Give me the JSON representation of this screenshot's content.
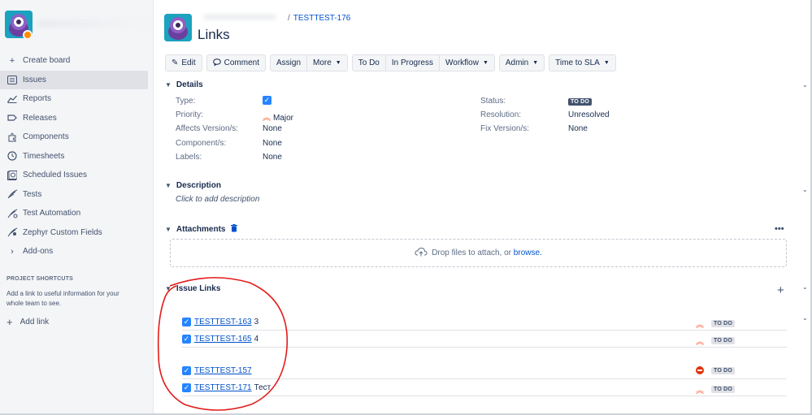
{
  "sidebar": {
    "items": [
      {
        "label": "Create board",
        "icon": "plus-icon"
      },
      {
        "label": "Issues",
        "icon": "issues-icon",
        "active": true
      },
      {
        "label": "Reports",
        "icon": "reports-icon"
      },
      {
        "label": "Releases",
        "icon": "releases-icon"
      },
      {
        "label": "Components",
        "icon": "components-icon"
      },
      {
        "label": "Timesheets",
        "icon": "timesheets-icon"
      },
      {
        "label": "Scheduled Issues",
        "icon": "scheduled-issues-icon"
      },
      {
        "label": "Tests",
        "icon": "tests-icon"
      },
      {
        "label": "Test Automation",
        "icon": "test-automation-icon"
      },
      {
        "label": "Zephyr Custom Fields",
        "icon": "zephyr-icon"
      },
      {
        "label": "Add-ons",
        "icon": "chevron-right-icon"
      }
    ],
    "shortcuts_title": "PROJECT SHORTCUTS",
    "shortcuts_text": "Add a link to useful information for your whole team to see.",
    "add_link": "Add link"
  },
  "header": {
    "breadcrumb_sep": "/",
    "issue_key": "TESTTEST-176",
    "title": "Links"
  },
  "toolbar": {
    "edit": "Edit",
    "comment": "Comment",
    "assign": "Assign",
    "more": "More",
    "todo": "To Do",
    "in_progress": "In Progress",
    "workflow": "Workflow",
    "admin": "Admin",
    "time_to_sla": "Time to SLA"
  },
  "details": {
    "title": "Details",
    "type_label": "Type:",
    "priority_label": "Priority:",
    "priority_value": "Major",
    "affects_label": "Affects Version/s:",
    "affects_value": "None",
    "component_label": "Component/s:",
    "component_value": "None",
    "labels_label": "Labels:",
    "labels_value": "None",
    "status_label": "Status:",
    "status_value": "TO DO",
    "resolution_label": "Resolution:",
    "resolution_value": "Unresolved",
    "fix_label": "Fix Version/s:",
    "fix_value": "None"
  },
  "description": {
    "title": "Description",
    "placeholder": "Click to add description"
  },
  "attachments": {
    "title": "Attachments",
    "drop_text": "Drop files to attach, or",
    "browse": "browse.",
    "more": "•••"
  },
  "issue_links": {
    "title": "Issue Links",
    "items": [
      {
        "key": "TESTTEST-163",
        "summary": "3",
        "priority": "major",
        "status": "TO DO"
      },
      {
        "key": "TESTTEST-165",
        "summary": "4",
        "priority": "major",
        "status": "TO DO"
      },
      {
        "key": "TESTTEST-157",
        "summary": "",
        "priority": "blocker",
        "status": "TO DO"
      },
      {
        "key": "TESTTEST-171",
        "summary": "Тест",
        "priority": "major",
        "status": "TO DO"
      }
    ]
  },
  "colors": {
    "link": "#0052cc",
    "checkbox": "#2684ff",
    "priority": "#ff5630",
    "annotation": "#e31b1b"
  }
}
